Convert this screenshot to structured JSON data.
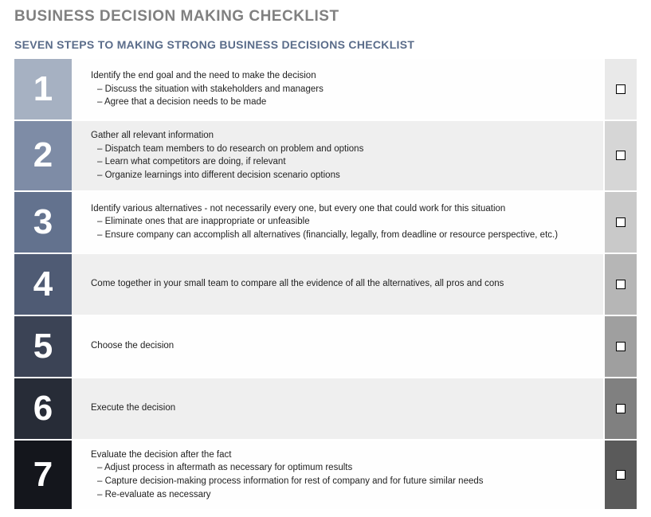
{
  "title": "BUSINESS DECISION MAKING CHECKLIST",
  "subtitle": "SEVEN STEPS TO MAKING STRONG BUSINESS DECISIONS CHECKLIST",
  "steps": [
    {
      "num": "1",
      "numColor": "#a6b1c2",
      "checkColor": "#e9e9e9",
      "textBg": "#fefefe",
      "main": "Identify the end goal and the need to make the decision",
      "subs": [
        "– Discuss the situation with stakeholders and managers",
        "– Agree that a decision needs to be made"
      ]
    },
    {
      "num": "2",
      "numColor": "#7e8ca6",
      "checkColor": "#d6d6d6",
      "textBg": "#efefef",
      "main": "Gather all relevant information",
      "subs": [
        "– Dispatch team members to do research on problem and options",
        "– Learn what competitors are doing, if relevant",
        "– Organize learnings into different decision scenario options"
      ]
    },
    {
      "num": "3",
      "numColor": "#63728e",
      "checkColor": "#c9c9c9",
      "textBg": "#fefefe",
      "main": "Identify various alternatives - not necessarily every one, but every one that could work for this situation",
      "subs": [
        "– Eliminate ones that are inappropriate or unfeasible",
        "– Ensure company can accomplish all alternatives (financially, legally, from deadline or resource perspective, etc.)"
      ]
    },
    {
      "num": "4",
      "numColor": "#4f5b74",
      "checkColor": "#b6b6b6",
      "textBg": "#efefef",
      "main": "Come together in your small team to compare all the evidence of all the alternatives, all pros and cons",
      "subs": []
    },
    {
      "num": "5",
      "numColor": "#3b4355",
      "checkColor": "#9f9f9f",
      "textBg": "#fefefe",
      "main": "Choose the decision",
      "subs": []
    },
    {
      "num": "6",
      "numColor": "#272c37",
      "checkColor": "#808080",
      "textBg": "#efefef",
      "main": "Execute the decision",
      "subs": []
    },
    {
      "num": "7",
      "numColor": "#14161c",
      "checkColor": "#5a5a5a",
      "textBg": "#fefefe",
      "main": "Evaluate the decision after the fact",
      "subs": [
        "– Adjust process in aftermath as necessary for optimum results",
        "– Capture decision-making process information for rest of company and for future similar needs",
        "– Re-evaluate as necessary"
      ]
    }
  ]
}
